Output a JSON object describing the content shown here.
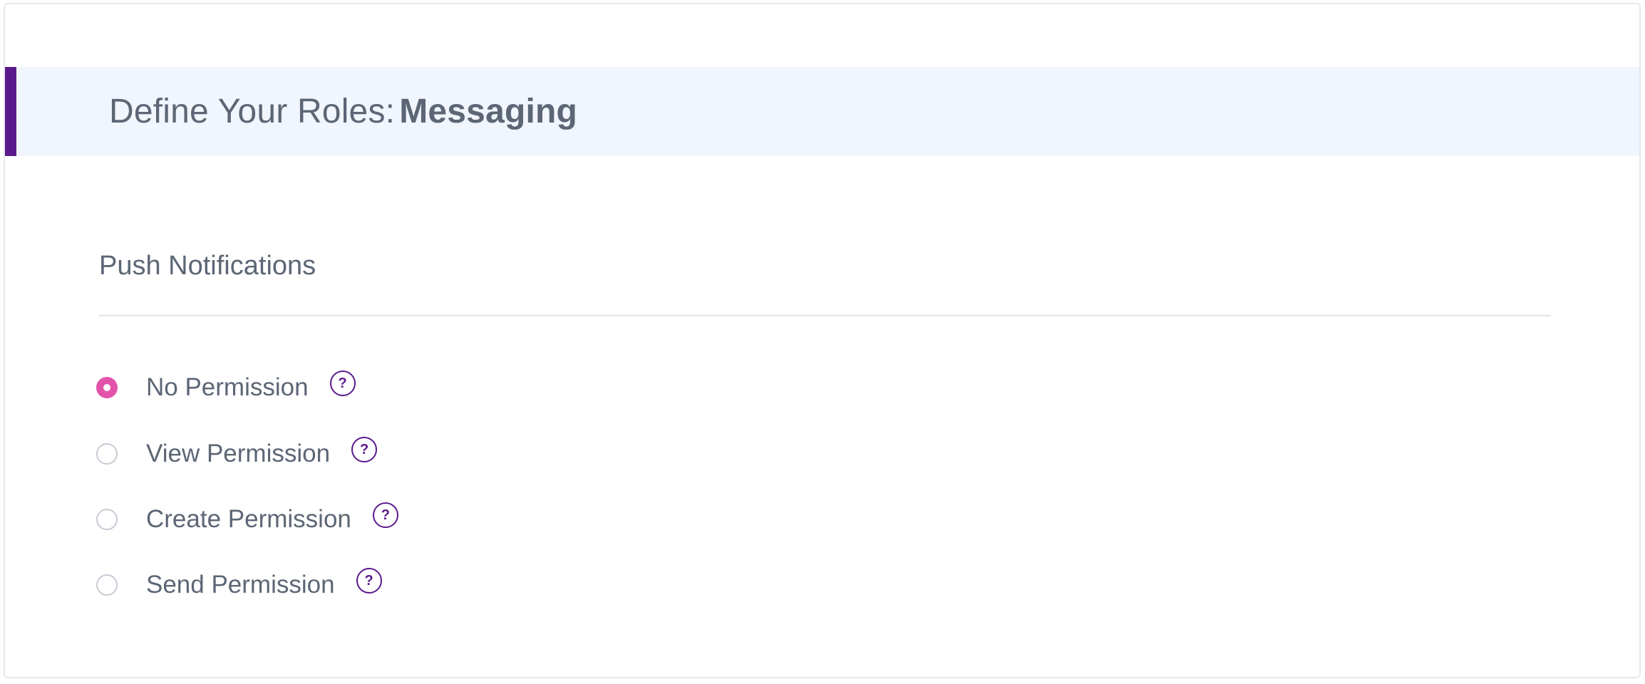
{
  "header": {
    "prefix": "Define Your Roles:",
    "module": "Messaging"
  },
  "section": {
    "title": "Push Notifications"
  },
  "options": [
    {
      "label": "No Permission",
      "selected": true,
      "help": "?"
    },
    {
      "label": "View Permission",
      "selected": false,
      "help": "?"
    },
    {
      "label": "Create Permission",
      "selected": false,
      "help": "?"
    },
    {
      "label": "Send Permission",
      "selected": false,
      "help": "?"
    }
  ],
  "colors": {
    "accent": "#5b1a8c",
    "selected_radio": "#e254aa",
    "header_band": "#f1f5fd",
    "text": "#5c6675"
  },
  "icons": {
    "help": "question-circle-icon"
  }
}
